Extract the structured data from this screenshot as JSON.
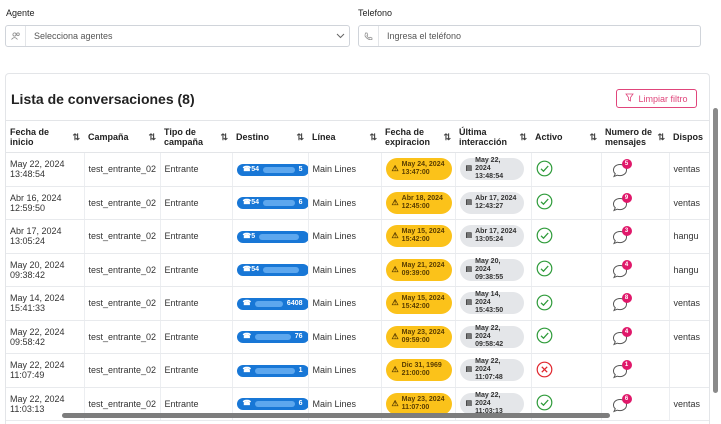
{
  "filters": {
    "agent_label": "Agente",
    "agent_placeholder": "Selecciona agentes",
    "phone_label": "Telefono",
    "phone_placeholder": "Ingresa el teléfono"
  },
  "list": {
    "title": "Lista de conversaciones (8)",
    "clear_filter_label": "Limpiar filtro"
  },
  "columns": [
    "Fecha de inicio",
    "Campaña",
    "Tipo de campaña",
    "Destino",
    "Línea",
    "Fecha de expiracion",
    "Última interacción",
    "Activo",
    "Numero de mensajes",
    "Dispos"
  ],
  "rows": [
    {
      "start": "May 22, 2024 13:48:54",
      "campaign": "test_entrante_02",
      "type": "Entrante",
      "dest": "54",
      "dest_end": "5",
      "line": "Main Lines",
      "exp": "May 24, 2024 13:47:00",
      "last": "May 22, 2024 13:48:54",
      "active": true,
      "msgs": "5",
      "disp": "ventas"
    },
    {
      "start": "Abr 16, 2024 12:59:50",
      "campaign": "test_entrante_02",
      "type": "Entrante",
      "dest": "54",
      "dest_end": "6",
      "line": "Main Lines",
      "exp": "Abr 18, 2024 12:45:00",
      "last": "Abr 17, 2024 12:43:27",
      "active": true,
      "msgs": "9",
      "disp": "ventas"
    },
    {
      "start": "Abr 17, 2024 13:05:24",
      "campaign": "test_entrante_02",
      "type": "Entrante",
      "dest": "5",
      "dest_end": "",
      "line": "Main Lines",
      "exp": "May 15, 2024 15:42:00",
      "last": "Abr 17, 2024 13:05:24",
      "active": true,
      "msgs": "3",
      "disp": "hangu"
    },
    {
      "start": "May 20, 2024 09:38:42",
      "campaign": "test_entrante_02",
      "type": "Entrante",
      "dest": "54",
      "dest_end": "",
      "line": "Main Lines",
      "exp": "May 21, 2024 09:39:00",
      "last": "May 20, 2024 09:38:55",
      "active": true,
      "msgs": "4",
      "disp": "hangu"
    },
    {
      "start": "May 14, 2024 15:41:33",
      "campaign": "test_entrante_02",
      "type": "Entrante",
      "dest": "",
      "dest_end": "6408",
      "line": "Main Lines",
      "exp": "May 15, 2024 15:42:00",
      "last": "May 14, 2024 15:43:50",
      "active": true,
      "msgs": "8",
      "disp": "ventas"
    },
    {
      "start": "May 22, 2024 09:58:42",
      "campaign": "test_entrante_02",
      "type": "Entrante",
      "dest": "",
      "dest_end": "76",
      "line": "Main Lines",
      "exp": "May 23, 2024 09:59:00",
      "last": "May 22, 2024 09:58:42",
      "active": true,
      "msgs": "4",
      "disp": "ventas"
    },
    {
      "start": "May 22, 2024 11:07:49",
      "campaign": "test_entrante_02",
      "type": "Entrante",
      "dest": "",
      "dest_end": "1",
      "line": "Main Lines",
      "exp": "Dic 31, 1969 21:00:00",
      "last": "May 22, 2024 11:07:48",
      "active": false,
      "msgs": "1",
      "disp": ""
    },
    {
      "start": "May 22, 2024 11:03:13",
      "campaign": "test_entrante_02",
      "type": "Entrante",
      "dest": "",
      "dest_end": "6",
      "line": "Main Lines",
      "exp": "May 23, 2024 11:07:00",
      "last": "May 22, 2024 11:03:13",
      "active": true,
      "msgs": "6",
      "disp": "ventas"
    }
  ],
  "colors": {
    "accent": "#e0457b",
    "phone": "#1877d6",
    "expiry": "#fbc21a",
    "active": "#2e9b3a",
    "inactive": "#e0262d",
    "badge": "#e0186a"
  },
  "icons": {
    "agent": "users-icon",
    "phone": "phone-icon",
    "clear": "filter-icon",
    "sort": "sort-icon",
    "active": "check-circle-icon",
    "inactive": "x-circle-icon",
    "messages": "chat-bubble-icon"
  }
}
